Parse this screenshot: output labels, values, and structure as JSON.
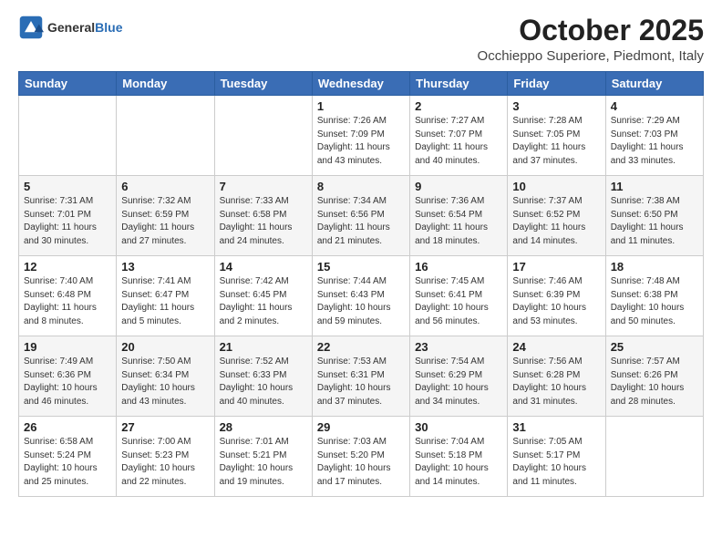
{
  "header": {
    "logo_general": "General",
    "logo_blue": "Blue",
    "month": "October 2025",
    "location": "Occhieppo Superiore, Piedmont, Italy"
  },
  "weekdays": [
    "Sunday",
    "Monday",
    "Tuesday",
    "Wednesday",
    "Thursday",
    "Friday",
    "Saturday"
  ],
  "weeks": [
    [
      {
        "day": "",
        "info": ""
      },
      {
        "day": "",
        "info": ""
      },
      {
        "day": "",
        "info": ""
      },
      {
        "day": "1",
        "info": "Sunrise: 7:26 AM\nSunset: 7:09 PM\nDaylight: 11 hours\nand 43 minutes."
      },
      {
        "day": "2",
        "info": "Sunrise: 7:27 AM\nSunset: 7:07 PM\nDaylight: 11 hours\nand 40 minutes."
      },
      {
        "day": "3",
        "info": "Sunrise: 7:28 AM\nSunset: 7:05 PM\nDaylight: 11 hours\nand 37 minutes."
      },
      {
        "day": "4",
        "info": "Sunrise: 7:29 AM\nSunset: 7:03 PM\nDaylight: 11 hours\nand 33 minutes."
      }
    ],
    [
      {
        "day": "5",
        "info": "Sunrise: 7:31 AM\nSunset: 7:01 PM\nDaylight: 11 hours\nand 30 minutes."
      },
      {
        "day": "6",
        "info": "Sunrise: 7:32 AM\nSunset: 6:59 PM\nDaylight: 11 hours\nand 27 minutes."
      },
      {
        "day": "7",
        "info": "Sunrise: 7:33 AM\nSunset: 6:58 PM\nDaylight: 11 hours\nand 24 minutes."
      },
      {
        "day": "8",
        "info": "Sunrise: 7:34 AM\nSunset: 6:56 PM\nDaylight: 11 hours\nand 21 minutes."
      },
      {
        "day": "9",
        "info": "Sunrise: 7:36 AM\nSunset: 6:54 PM\nDaylight: 11 hours\nand 18 minutes."
      },
      {
        "day": "10",
        "info": "Sunrise: 7:37 AM\nSunset: 6:52 PM\nDaylight: 11 hours\nand 14 minutes."
      },
      {
        "day": "11",
        "info": "Sunrise: 7:38 AM\nSunset: 6:50 PM\nDaylight: 11 hours\nand 11 minutes."
      }
    ],
    [
      {
        "day": "12",
        "info": "Sunrise: 7:40 AM\nSunset: 6:48 PM\nDaylight: 11 hours\nand 8 minutes."
      },
      {
        "day": "13",
        "info": "Sunrise: 7:41 AM\nSunset: 6:47 PM\nDaylight: 11 hours\nand 5 minutes."
      },
      {
        "day": "14",
        "info": "Sunrise: 7:42 AM\nSunset: 6:45 PM\nDaylight: 11 hours\nand 2 minutes."
      },
      {
        "day": "15",
        "info": "Sunrise: 7:44 AM\nSunset: 6:43 PM\nDaylight: 10 hours\nand 59 minutes."
      },
      {
        "day": "16",
        "info": "Sunrise: 7:45 AM\nSunset: 6:41 PM\nDaylight: 10 hours\nand 56 minutes."
      },
      {
        "day": "17",
        "info": "Sunrise: 7:46 AM\nSunset: 6:39 PM\nDaylight: 10 hours\nand 53 minutes."
      },
      {
        "day": "18",
        "info": "Sunrise: 7:48 AM\nSunset: 6:38 PM\nDaylight: 10 hours\nand 50 minutes."
      }
    ],
    [
      {
        "day": "19",
        "info": "Sunrise: 7:49 AM\nSunset: 6:36 PM\nDaylight: 10 hours\nand 46 minutes."
      },
      {
        "day": "20",
        "info": "Sunrise: 7:50 AM\nSunset: 6:34 PM\nDaylight: 10 hours\nand 43 minutes."
      },
      {
        "day": "21",
        "info": "Sunrise: 7:52 AM\nSunset: 6:33 PM\nDaylight: 10 hours\nand 40 minutes."
      },
      {
        "day": "22",
        "info": "Sunrise: 7:53 AM\nSunset: 6:31 PM\nDaylight: 10 hours\nand 37 minutes."
      },
      {
        "day": "23",
        "info": "Sunrise: 7:54 AM\nSunset: 6:29 PM\nDaylight: 10 hours\nand 34 minutes."
      },
      {
        "day": "24",
        "info": "Sunrise: 7:56 AM\nSunset: 6:28 PM\nDaylight: 10 hours\nand 31 minutes."
      },
      {
        "day": "25",
        "info": "Sunrise: 7:57 AM\nSunset: 6:26 PM\nDaylight: 10 hours\nand 28 minutes."
      }
    ],
    [
      {
        "day": "26",
        "info": "Sunrise: 6:58 AM\nSunset: 5:24 PM\nDaylight: 10 hours\nand 25 minutes."
      },
      {
        "day": "27",
        "info": "Sunrise: 7:00 AM\nSunset: 5:23 PM\nDaylight: 10 hours\nand 22 minutes."
      },
      {
        "day": "28",
        "info": "Sunrise: 7:01 AM\nSunset: 5:21 PM\nDaylight: 10 hours\nand 19 minutes."
      },
      {
        "day": "29",
        "info": "Sunrise: 7:03 AM\nSunset: 5:20 PM\nDaylight: 10 hours\nand 17 minutes."
      },
      {
        "day": "30",
        "info": "Sunrise: 7:04 AM\nSunset: 5:18 PM\nDaylight: 10 hours\nand 14 minutes."
      },
      {
        "day": "31",
        "info": "Sunrise: 7:05 AM\nSunset: 5:17 PM\nDaylight: 10 hours\nand 11 minutes."
      },
      {
        "day": "",
        "info": ""
      }
    ]
  ]
}
